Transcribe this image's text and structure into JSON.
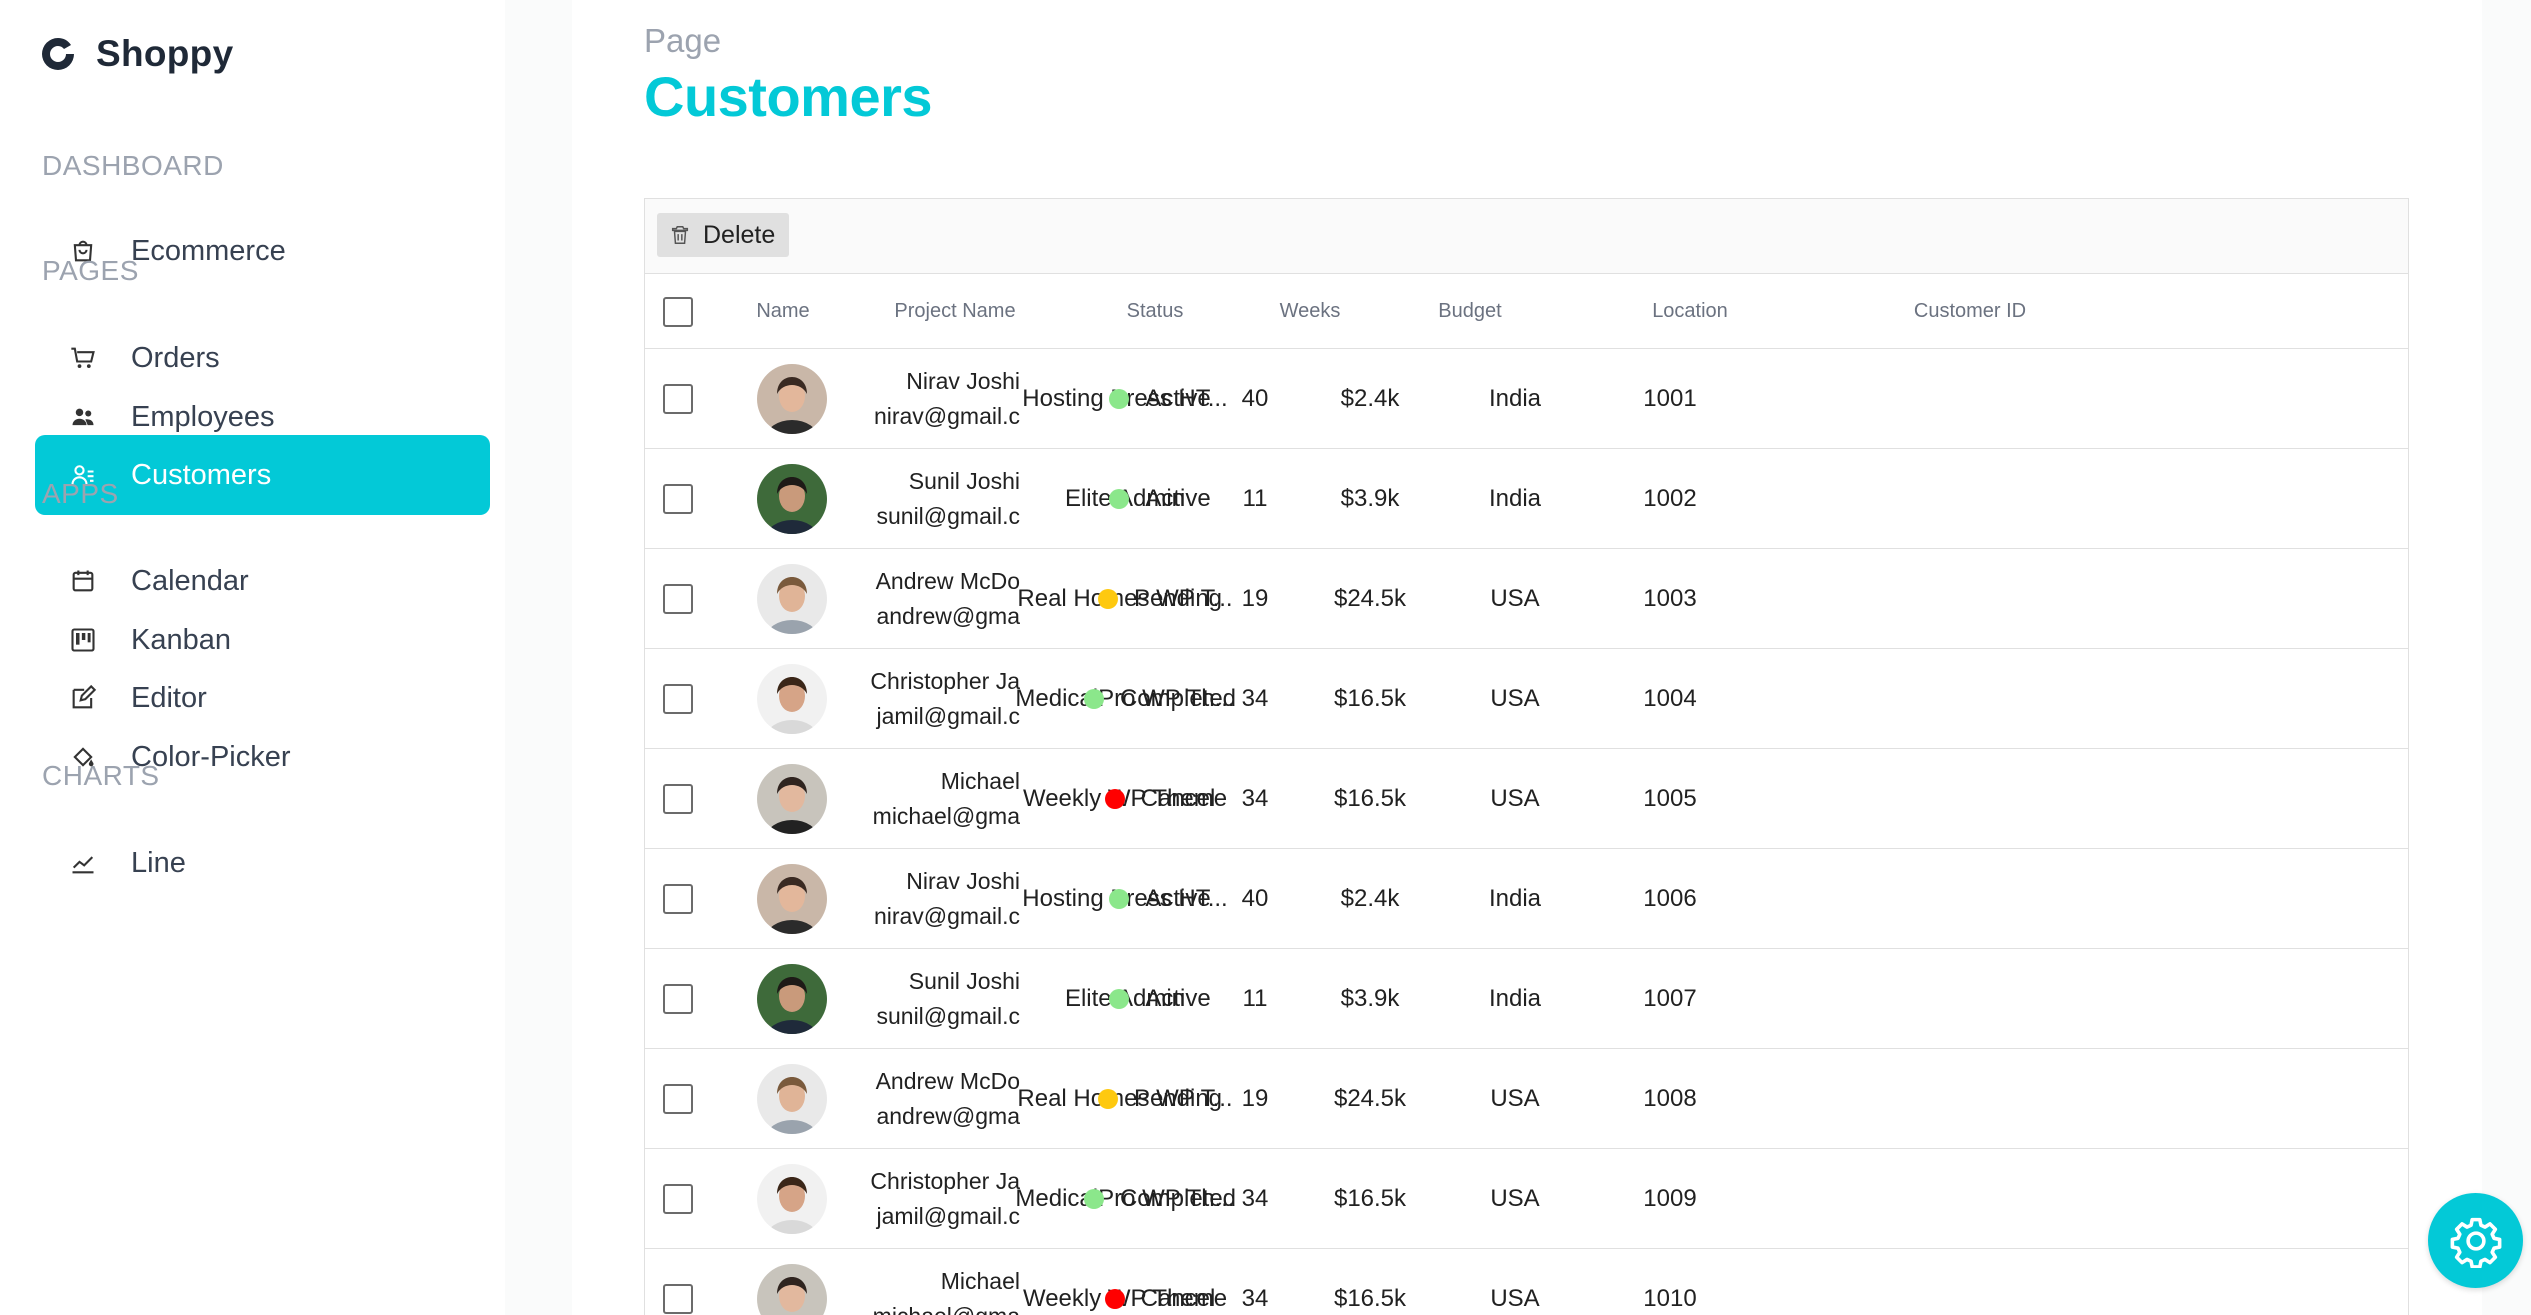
{
  "brand": {
    "name": "Shoppy"
  },
  "sidebar": {
    "sections": [
      {
        "title": "DASHBOARD",
        "items": [
          {
            "label": "Ecommerce",
            "icon": "shopping-bag-icon"
          }
        ]
      },
      {
        "title": "PAGES",
        "items": [
          {
            "label": "Orders",
            "icon": "cart-icon"
          },
          {
            "label": "Employees",
            "icon": "people-icon"
          },
          {
            "label": "Customers",
            "icon": "customers-icon",
            "active": true
          }
        ]
      },
      {
        "title": "APPS",
        "items": [
          {
            "label": "Calendar",
            "icon": "calendar-icon"
          },
          {
            "label": "Kanban",
            "icon": "kanban-icon"
          },
          {
            "label": "Editor",
            "icon": "edit-icon"
          },
          {
            "label": "Color-Picker",
            "icon": "paint-bucket-icon"
          }
        ]
      },
      {
        "title": "CHARTS",
        "items": [
          {
            "label": "Line",
            "icon": "line-chart-icon"
          }
        ]
      }
    ]
  },
  "page": {
    "eyebrow": "Page",
    "title": "Customers"
  },
  "toolbar": {
    "delete_label": "Delete"
  },
  "table": {
    "columns": [
      "Name",
      "Project Name",
      "Status",
      "Weeks",
      "Budget",
      "Location",
      "Customer ID"
    ],
    "rows": [
      {
        "name": "Nirav Joshi",
        "email": "nirav@gmail.c",
        "project": "Hosting Press HT...",
        "status": "Active",
        "status_color": "#8be78b",
        "weeks": "40",
        "budget": "$2.4k",
        "location": "India",
        "id": "1001",
        "avatar": "a"
      },
      {
        "name": "Sunil Joshi",
        "email": "sunil@gmail.c",
        "project": "Elite Admin",
        "status": "Active",
        "status_color": "#8be78b",
        "weeks": "11",
        "budget": "$3.9k",
        "location": "India",
        "id": "1002",
        "avatar": "b"
      },
      {
        "name": "Andrew McDo",
        "email": "andrew@gma",
        "project": "Real Homes WP T...",
        "status": "Pending",
        "status_color": "#fec90f",
        "weeks": "19",
        "budget": "$24.5k",
        "location": "USA",
        "id": "1003",
        "avatar": "c"
      },
      {
        "name": "Christopher Ja",
        "email": "jamil@gmail.c",
        "project": "MedicalPro WP Th...",
        "status": "Completed",
        "status_color": "#8be78b",
        "weeks": "34",
        "budget": "$16.5k",
        "location": "USA",
        "id": "1004",
        "avatar": "d"
      },
      {
        "name": "Michael",
        "email": "michael@gma",
        "project": "Weekly WP Theme",
        "status": "Cancel",
        "status_color": "#ff0000",
        "weeks": "34",
        "budget": "$16.5k",
        "location": "USA",
        "id": "1005",
        "avatar": "e"
      },
      {
        "name": "Nirav Joshi",
        "email": "nirav@gmail.c",
        "project": "Hosting Press HT...",
        "status": "Active",
        "status_color": "#8be78b",
        "weeks": "40",
        "budget": "$2.4k",
        "location": "India",
        "id": "1006",
        "avatar": "a"
      },
      {
        "name": "Sunil Joshi",
        "email": "sunil@gmail.c",
        "project": "Elite Admin",
        "status": "Active",
        "status_color": "#8be78b",
        "weeks": "11",
        "budget": "$3.9k",
        "location": "India",
        "id": "1007",
        "avatar": "b"
      },
      {
        "name": "Andrew McDo",
        "email": "andrew@gma",
        "project": "Real Homes WP T...",
        "status": "Pending",
        "status_color": "#fec90f",
        "weeks": "19",
        "budget": "$24.5k",
        "location": "USA",
        "id": "1008",
        "avatar": "c"
      },
      {
        "name": "Christopher Ja",
        "email": "jamil@gmail.c",
        "project": "MedicalPro WP Th...",
        "status": "Completed",
        "status_color": "#8be78b",
        "weeks": "34",
        "budget": "$16.5k",
        "location": "USA",
        "id": "1009",
        "avatar": "d"
      },
      {
        "name": "Michael",
        "email": "michael@gma",
        "project": "Weekly WP Theme",
        "status": "Cancel",
        "status_color": "#ff0000",
        "weeks": "34",
        "budget": "$16.5k",
        "location": "USA",
        "id": "1010",
        "avatar": "e"
      }
    ]
  },
  "colors": {
    "accent": "#03c9d7"
  },
  "settings_button": {
    "icon": "gear-icon"
  }
}
